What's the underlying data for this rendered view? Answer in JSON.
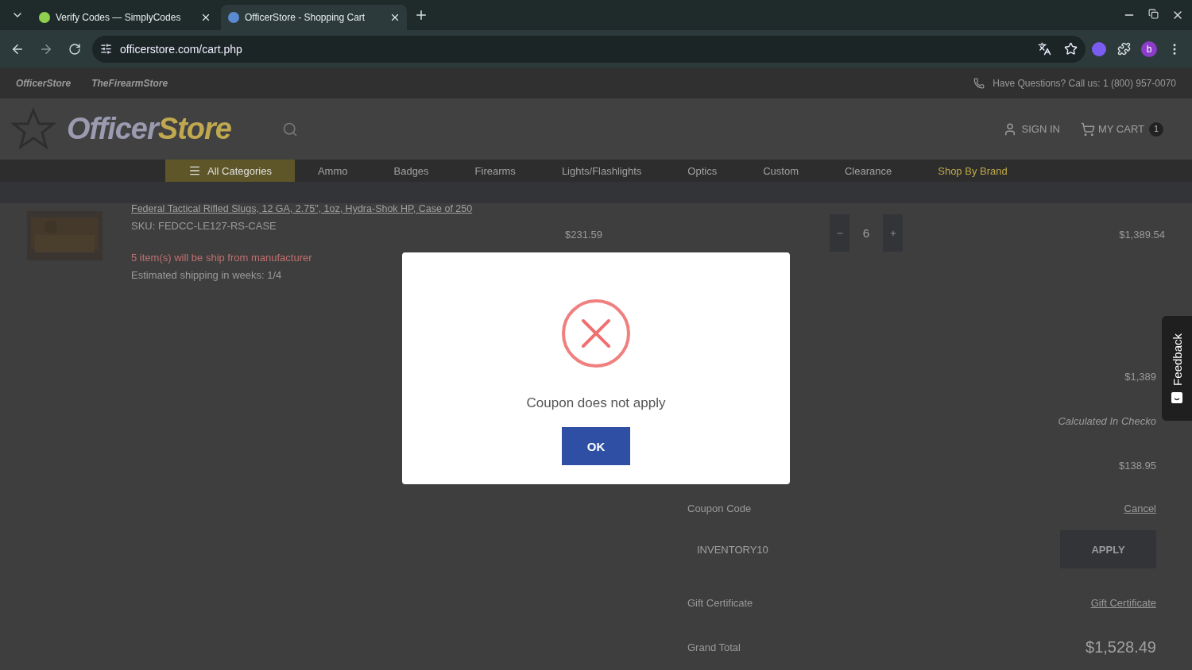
{
  "browser": {
    "tabs": [
      {
        "title": "Verify Codes — SimplyCodes",
        "selected": false
      },
      {
        "title": "OfficerStore - Shopping Cart",
        "selected": true
      }
    ],
    "url": "officerstore.com/cart.php",
    "profile": "b"
  },
  "topbar": {
    "sites": [
      "OfficerStore",
      "TheFirearmStore"
    ],
    "contact": "Have Questions?  Call us: 1 (800) 957-0070"
  },
  "header": {
    "logo": [
      "Officer",
      "Store"
    ],
    "sign_in": "SIGN IN",
    "cart": "MY CART",
    "cart_count": "1"
  },
  "nav": [
    {
      "label": "All Categories",
      "kind": "menu"
    },
    {
      "label": "Ammo",
      "kind": "link"
    },
    {
      "label": "Badges",
      "kind": "link"
    },
    {
      "label": "Firearms",
      "kind": "link"
    },
    {
      "label": "Lights/Flashlights",
      "kind": "link"
    },
    {
      "label": "Optics",
      "kind": "link"
    },
    {
      "label": "Custom",
      "kind": "link"
    },
    {
      "label": "Clearance",
      "kind": "link"
    },
    {
      "label": "Shop By Brand",
      "kind": "brand"
    }
  ],
  "cart_item": {
    "name": "Federal Tactical Rifled Slugs, 12 GA, 2.75\", 1oz, Hydra-Shok HP, Case of 250",
    "sku": "SKU: FEDCC-LE127-RS-CASE",
    "price": "$231.59",
    "quantity": "6",
    "total": "$1,389.54",
    "notice": "5 item(s) will be ship from manufacturer",
    "shipping": "Estimated shipping in weeks: 1/4"
  },
  "summary": {
    "subtotal": "$1,389",
    "shipping": "Calculated In Checko",
    "tax": "$138.95",
    "coupon_label": "Coupon Code",
    "coupon_cancel": "Cancel",
    "coupon_value": "INVENTORY10",
    "apply": "APPLY",
    "gift_label": "Gift Certificate",
    "gift_link": "Gift Certificate",
    "total_label": "Grand Total",
    "total": "$1,528.49"
  },
  "feedback": "Feedback",
  "dialog": {
    "message": "Coupon does not apply",
    "button": "OK"
  }
}
